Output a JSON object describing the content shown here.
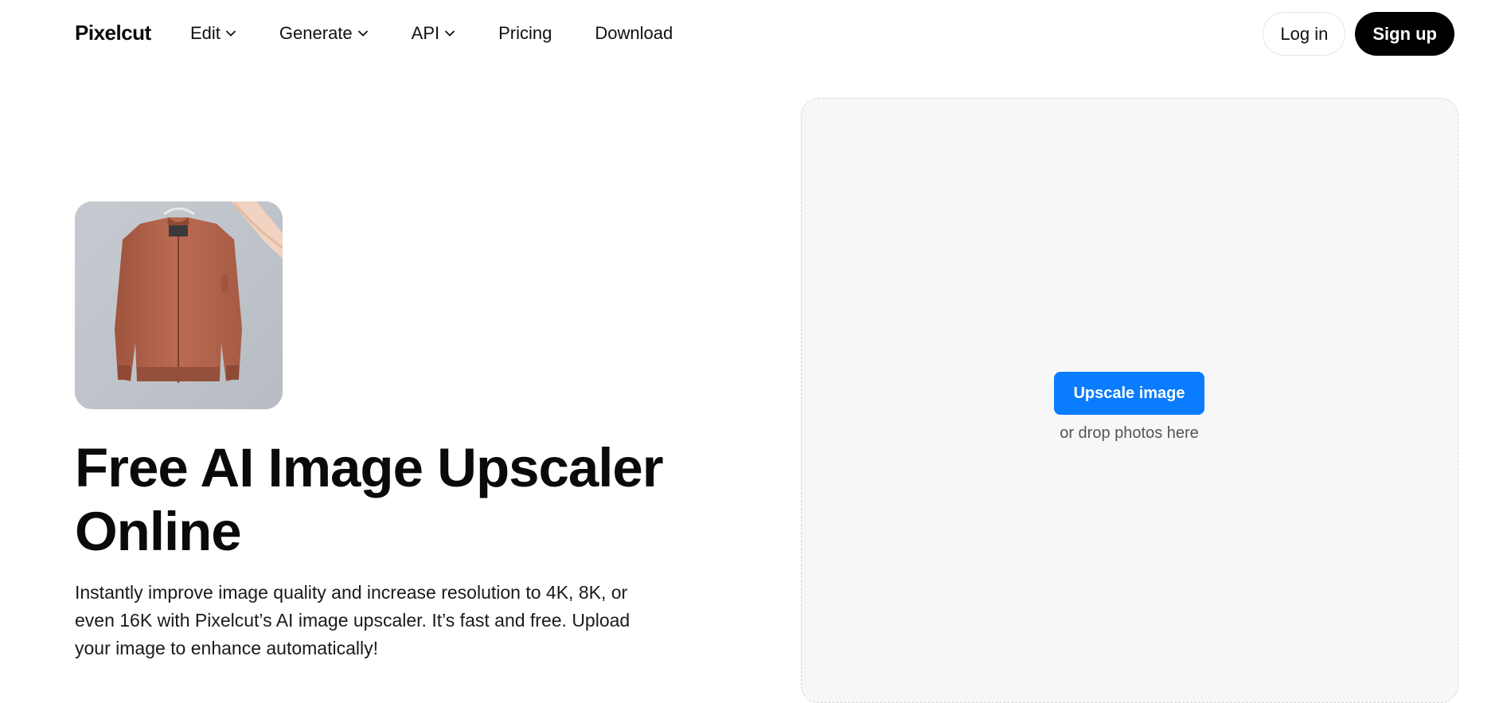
{
  "header": {
    "logo": "Pixelcut",
    "nav": [
      {
        "label": "Edit",
        "has_dropdown": true,
        "icon": "chevron-down-icon"
      },
      {
        "label": "Generate",
        "has_dropdown": true,
        "icon": "chevron-down-icon"
      },
      {
        "label": "API",
        "has_dropdown": true,
        "icon": "chevron-down-icon"
      },
      {
        "label": "Pricing",
        "has_dropdown": false
      },
      {
        "label": "Download",
        "has_dropdown": false
      }
    ],
    "login_label": "Log in",
    "signup_label": "Sign up"
  },
  "hero": {
    "image_alt_icon": "jacket-photo",
    "title_line_1": "Free AI Image Upscaler",
    "title_line_2": "Online",
    "description_line_1": "Instantly improve image quality and increase resolution to 4K, 8K, or",
    "description_line_2": "even 16K with Pixelcut’s AI image upscaler. It’s fast and free. Upload",
    "description_line_3": "your image to enhance automatically!"
  },
  "upload": {
    "button_label": "Upscale image",
    "drop_hint": "or drop photos here"
  },
  "colors": {
    "accent": "#0a7cff",
    "signup_bg": "#000000",
    "dropzone_bg": "#f7f7f7",
    "jacket": "#b5664d"
  }
}
